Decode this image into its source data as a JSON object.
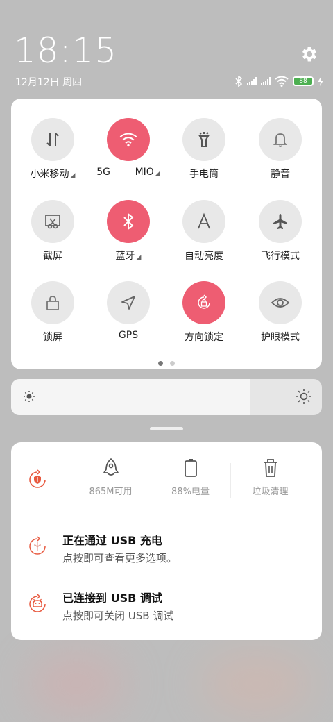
{
  "status": {
    "time": "18:15",
    "date": "12月12日 周四",
    "battery_level": "88",
    "icons": [
      "bluetooth-icon",
      "signal-icon",
      "signal-icon",
      "wifi-icon",
      "battery-icon",
      "charging-icon",
      "gear-icon"
    ]
  },
  "tiles": [
    {
      "label": "小米移动",
      "icon": "data-transfer-icon",
      "active": false,
      "dropdown": true
    },
    {
      "label": "5G        MIO",
      "icon": "wifi-icon",
      "active": true,
      "dropdown": true
    },
    {
      "label": "手电筒",
      "icon": "flashlight-icon",
      "active": false,
      "dropdown": false
    },
    {
      "label": "静音",
      "icon": "bell-icon",
      "active": false,
      "dropdown": false
    },
    {
      "label": "截屏",
      "icon": "screenshot-icon",
      "active": false,
      "dropdown": false
    },
    {
      "label": "蓝牙",
      "icon": "bluetooth-icon",
      "active": true,
      "dropdown": true
    },
    {
      "label": "自动亮度",
      "icon": "auto-brightness-icon",
      "active": false,
      "dropdown": false
    },
    {
      "label": "飞行模式",
      "icon": "airplane-icon",
      "active": false,
      "dropdown": false
    },
    {
      "label": "锁屏",
      "icon": "lock-icon",
      "active": false,
      "dropdown": false
    },
    {
      "label": "GPS",
      "icon": "gps-icon",
      "active": false,
      "dropdown": false
    },
    {
      "label": "方向锁定",
      "icon": "rotation-lock-icon",
      "active": true,
      "dropdown": false
    },
    {
      "label": "护眼模式",
      "icon": "eye-icon",
      "active": false,
      "dropdown": false
    }
  ],
  "brightness": {
    "level": 0.77
  },
  "cleaner": {
    "memory_label": "865M可用",
    "battery_label": "88%电量",
    "trash_label": "垃圾清理"
  },
  "notifications": [
    {
      "title": "正在通过 USB 充电",
      "subtitle": "点按即可查看更多选项。",
      "icon": "usb-icon"
    },
    {
      "title": "已连接到 USB 调试",
      "subtitle": "点按即可关闭 USB 调试",
      "icon": "android-debug-icon"
    }
  ],
  "colors": {
    "accent": "#ee5d72",
    "tile_off": "#e8e8e8",
    "notif_icon": "#e8593f"
  }
}
